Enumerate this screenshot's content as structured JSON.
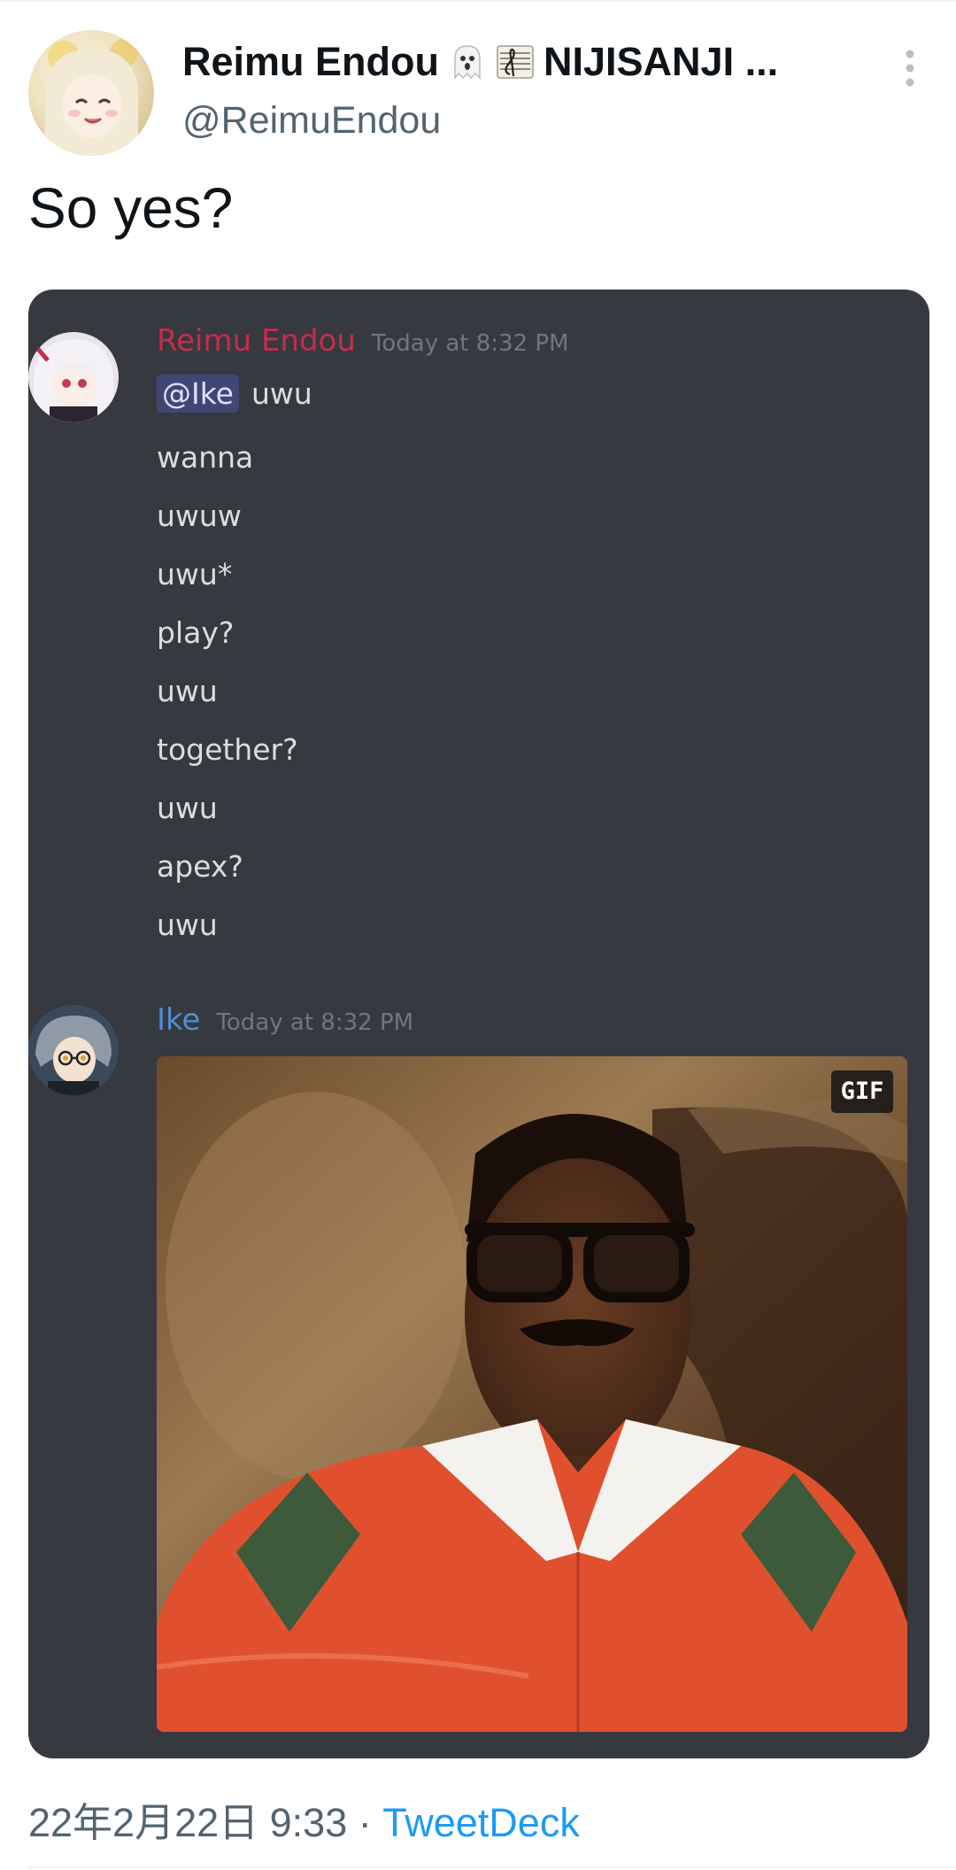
{
  "tweet": {
    "display_name": "Reimu Endou",
    "display_name_suffix": "NIJISANJI ...",
    "handle": "@ReimuEndou",
    "text": "So yes?",
    "date": "22年2月22日 9:33",
    "separator": " · ",
    "source": "TweetDeck"
  },
  "icons": [
    "ghost-emoji-icon",
    "musical-score-emoji-icon",
    "more-vertical-icon"
  ],
  "discord": {
    "messages": [
      {
        "author": "Reimu Endou",
        "author_color": "#c42d4e",
        "timestamp": "Today at 8:32 PM",
        "mention": "@Ike",
        "first_line": "uwu",
        "lines": [
          "wanna",
          "uwuw",
          "uwu*",
          "play?",
          "uwu",
          "together?",
          "uwu",
          "apex?",
          "uwu"
        ]
      },
      {
        "author": "Ike",
        "author_color": "#4f8fd4",
        "timestamp": "Today at 8:32 PM",
        "attachment_badge": "GIF"
      }
    ]
  }
}
